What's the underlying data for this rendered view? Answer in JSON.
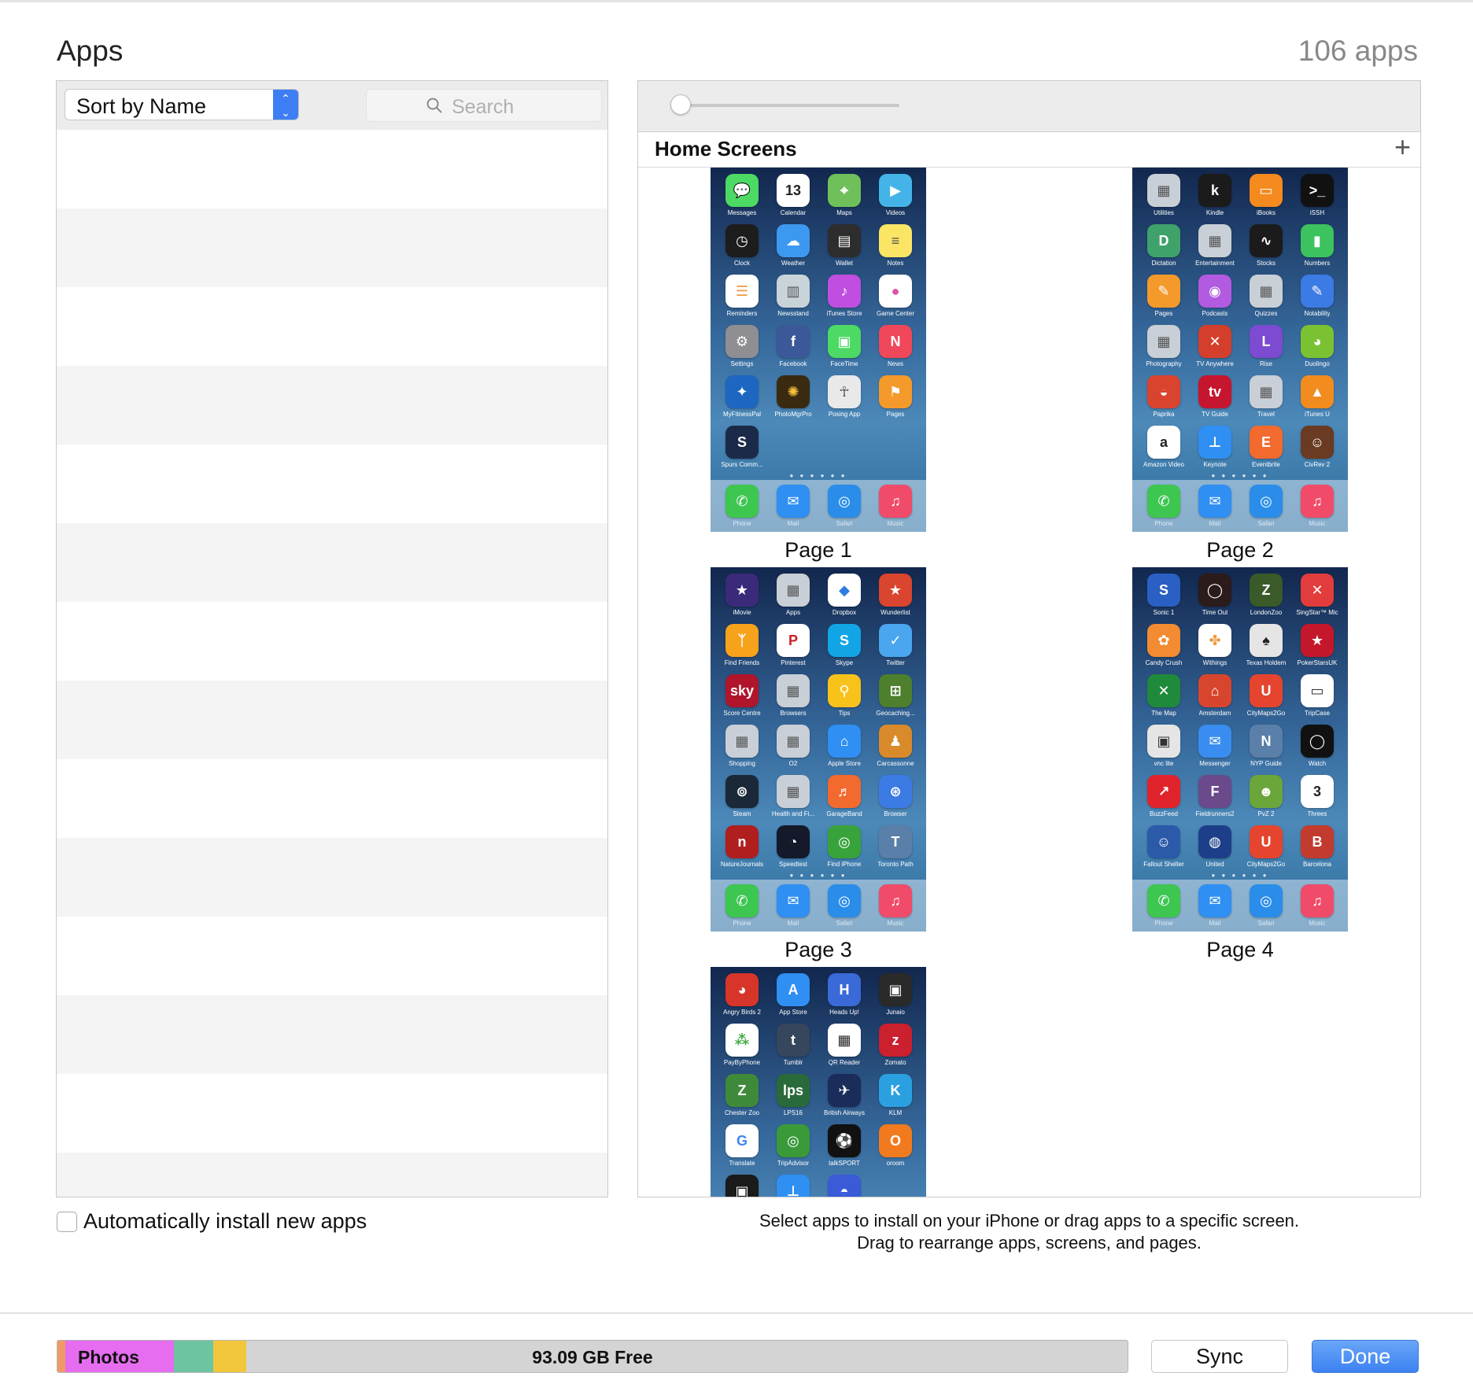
{
  "header": {
    "title": "Apps",
    "count": "106 apps"
  },
  "left": {
    "sort_label": "Sort by Name",
    "search_placeholder": "Search",
    "auto_install_label": "Automatically install new apps"
  },
  "right": {
    "section_title": "Home Screens",
    "add_symbol": "+",
    "hint_line1": "Select apps to install on your iPhone or drag apps to a specific screen.",
    "hint_line2": "Drag to rearrange apps, screens, and pages."
  },
  "dock": [
    {
      "label": "Phone",
      "color": "#3dc650",
      "glyph": "✆"
    },
    {
      "label": "Mail",
      "color": "#2f8ff2",
      "glyph": "✉"
    },
    {
      "label": "Safari",
      "color": "#2a8de9",
      "glyph": "◎"
    },
    {
      "label": "Music",
      "color": "#f14b6a",
      "glyph": "♫"
    }
  ],
  "pages": [
    {
      "label": "Page 1",
      "apps": [
        {
          "label": "Messages",
          "color": "#4cd964",
          "glyph": "💬"
        },
        {
          "label": "Calendar",
          "color": "#ffffff",
          "glyph": "13",
          "fg": "#222"
        },
        {
          "label": "Maps",
          "color": "#6fc05a",
          "glyph": "⌖"
        },
        {
          "label": "Videos",
          "color": "#44b4e8",
          "glyph": "▶"
        },
        {
          "label": "Clock",
          "color": "#1d1d1d",
          "glyph": "◷"
        },
        {
          "label": "Weather",
          "color": "#3d98f0",
          "glyph": "☁"
        },
        {
          "label": "Wallet",
          "color": "#2d2d2d",
          "glyph": "▤"
        },
        {
          "label": "Notes",
          "color": "#fbe565",
          "glyph": "≡",
          "fg": "#555"
        },
        {
          "label": "Reminders",
          "color": "#ffffff",
          "glyph": "☰",
          "fg": "#e94"
        },
        {
          "label": "Newsstand",
          "color": "#c9d4da",
          "glyph": "▥",
          "fg": "#555"
        },
        {
          "label": "iTunes Store",
          "color": "#c04ee0",
          "glyph": "♪"
        },
        {
          "label": "Game Center",
          "color": "#ffffff",
          "glyph": "●",
          "fg": "#d5a"
        },
        {
          "label": "Settings",
          "color": "#8e8e93",
          "glyph": "⚙"
        },
        {
          "label": "Facebook",
          "color": "#3b5998",
          "glyph": "f"
        },
        {
          "label": "FaceTime",
          "color": "#4cd964",
          "glyph": "▣"
        },
        {
          "label": "News",
          "color": "#f0475a",
          "glyph": "N"
        },
        {
          "label": "MyFitnessPal",
          "color": "#1d67c1",
          "glyph": "✦"
        },
        {
          "label": "PhotoMgrPro",
          "color": "#3a2a10",
          "glyph": "✺",
          "fg": "#f8c13a"
        },
        {
          "label": "Posing App",
          "color": "#e9e9e9",
          "glyph": "☥",
          "fg": "#555"
        },
        {
          "label": "Pages",
          "color": "#f39a2b",
          "glyph": "⚑"
        },
        {
          "label": "Spurs Comm...",
          "color": "#1c2a4a",
          "glyph": "S"
        }
      ]
    },
    {
      "label": "Page 2",
      "apps": [
        {
          "label": "Utilities",
          "color": "#c9cfd6",
          "glyph": "▦",
          "fg": "#555"
        },
        {
          "label": "Kindle",
          "color": "#1b1b1b",
          "glyph": "k"
        },
        {
          "label": "iBooks",
          "color": "#f58a1f",
          "glyph": "▭"
        },
        {
          "label": "iSSH",
          "color": "#111111",
          "glyph": ">_"
        },
        {
          "label": "Dictation",
          "color": "#3fa26b",
          "glyph": "D"
        },
        {
          "label": "Entertainment",
          "color": "#c9cfd6",
          "glyph": "▦",
          "fg": "#555"
        },
        {
          "label": "Stocks",
          "color": "#1b1b1b",
          "glyph": "∿"
        },
        {
          "label": "Numbers",
          "color": "#3cc35f",
          "glyph": "▮"
        },
        {
          "label": "Pages",
          "color": "#f39a2b",
          "glyph": "✎"
        },
        {
          "label": "Podcasts",
          "color": "#b25ae0",
          "glyph": "◉"
        },
        {
          "label": "Quizzes",
          "color": "#c9cfd6",
          "glyph": "▦",
          "fg": "#555"
        },
        {
          "label": "Notability",
          "color": "#3c7ae4",
          "glyph": "✎"
        },
        {
          "label": "Photography",
          "color": "#c9cfd6",
          "glyph": "▦",
          "fg": "#555"
        },
        {
          "label": "TV Anywhere",
          "color": "#d43f2c",
          "glyph": "✕"
        },
        {
          "label": "Rise",
          "color": "#7c4bd1",
          "glyph": "L"
        },
        {
          "label": "Duolingo",
          "color": "#7ac232",
          "glyph": "◕"
        },
        {
          "label": "Paprika",
          "color": "#d9442e",
          "glyph": "◒"
        },
        {
          "label": "TV Guide",
          "color": "#c6152f",
          "glyph": "tv"
        },
        {
          "label": "Travel",
          "color": "#c9cfd6",
          "glyph": "▦",
          "fg": "#555"
        },
        {
          "label": "iTunes U",
          "color": "#f28c1e",
          "glyph": "▲"
        },
        {
          "label": "Amazon Video",
          "color": "#ffffff",
          "glyph": "a",
          "fg": "#222"
        },
        {
          "label": "Keynote",
          "color": "#2f8ff2",
          "glyph": "⊥"
        },
        {
          "label": "Eventbrite",
          "color": "#f26a2e",
          "glyph": "E"
        },
        {
          "label": "CivRev 2",
          "color": "#6a3a22",
          "glyph": "☺"
        }
      ]
    },
    {
      "label": "Page 3",
      "apps": [
        {
          "label": "iMovie",
          "color": "#3b2a7a",
          "glyph": "★"
        },
        {
          "label": "Apps",
          "color": "#c9cfd6",
          "glyph": "▦",
          "fg": "#555"
        },
        {
          "label": "Dropbox",
          "color": "#ffffff",
          "glyph": "◆",
          "fg": "#2d7de1"
        },
        {
          "label": "Wunderlist",
          "color": "#d9452e",
          "glyph": "★"
        },
        {
          "label": "Find Friends",
          "color": "#f7a21b",
          "glyph": "ᛉ"
        },
        {
          "label": "Pinterest",
          "color": "#ffffff",
          "glyph": "P",
          "fg": "#cb2027"
        },
        {
          "label": "Skype",
          "color": "#12a5e6",
          "glyph": "S"
        },
        {
          "label": "Twitter",
          "color": "#4aa6ef",
          "glyph": "✓"
        },
        {
          "label": "Score Centre",
          "color": "#b0152c",
          "glyph": "sky"
        },
        {
          "label": "Browsers",
          "color": "#c9cfd6",
          "glyph": "▦",
          "fg": "#555"
        },
        {
          "label": "Tips",
          "color": "#f9c21b",
          "glyph": "⚲"
        },
        {
          "label": "Geocaching...",
          "color": "#4d7f2d",
          "glyph": "⊞"
        },
        {
          "label": "Shopping",
          "color": "#c9cfd6",
          "glyph": "▦",
          "fg": "#555"
        },
        {
          "label": "O2",
          "color": "#c9cfd6",
          "glyph": "▦",
          "fg": "#555"
        },
        {
          "label": "Apple Store",
          "color": "#2f8ff2",
          "glyph": "⌂"
        },
        {
          "label": "Carcassonne",
          "color": "#d98a2a",
          "glyph": "♟"
        },
        {
          "label": "Steam",
          "color": "#1b2838",
          "glyph": "⊚"
        },
        {
          "label": "Health and Fi...",
          "color": "#c9cfd6",
          "glyph": "▦",
          "fg": "#555"
        },
        {
          "label": "GarageBand",
          "color": "#f26a2e",
          "glyph": "♬"
        },
        {
          "label": "Browser",
          "color": "#3c7ae4",
          "glyph": "⊛"
        },
        {
          "label": "NatureJournals",
          "color": "#b01e1e",
          "glyph": "n"
        },
        {
          "label": "Speedtest",
          "color": "#141a2a",
          "glyph": "◔"
        },
        {
          "label": "Find iPhone",
          "color": "#38a33a",
          "glyph": "◎"
        },
        {
          "label": "Toronto Path",
          "color": "#5a7fa8",
          "glyph": "T"
        }
      ]
    },
    {
      "label": "Page 4",
      "apps": [
        {
          "label": "Sonic 1",
          "color": "#2a5fc4",
          "glyph": "S"
        },
        {
          "label": "Time Out",
          "color": "#2b1b1b",
          "glyph": "◯"
        },
        {
          "label": "LondonZoo",
          "color": "#3a5a2a",
          "glyph": "Z"
        },
        {
          "label": "SingStar™ Mic",
          "color": "#e23c3c",
          "glyph": "✕"
        },
        {
          "label": "Candy Crush",
          "color": "#f38b33",
          "glyph": "✿"
        },
        {
          "label": "Withings",
          "color": "#ffffff",
          "glyph": "✤",
          "fg": "#e94"
        },
        {
          "label": "Texas Holdem",
          "color": "#e5e5e5",
          "glyph": "♠",
          "fg": "#222"
        },
        {
          "label": "PokerStarsUK",
          "color": "#c5172b",
          "glyph": "★"
        },
        {
          "label": "The Map",
          "color": "#1f8a3b",
          "glyph": "✕"
        },
        {
          "label": "Amsterdam",
          "color": "#d8452e",
          "glyph": "⌂"
        },
        {
          "label": "CityMaps2Go",
          "color": "#e5452e",
          "glyph": "U"
        },
        {
          "label": "TripCase",
          "color": "#ffffff",
          "glyph": "▭",
          "fg": "#333"
        },
        {
          "label": "vnc lite",
          "color": "#e5e5e5",
          "glyph": "▣",
          "fg": "#333"
        },
        {
          "label": "Messenger",
          "color": "#3a8df0",
          "glyph": "✉"
        },
        {
          "label": "NYP Guide",
          "color": "#5a7fa8",
          "glyph": "N"
        },
        {
          "label": "Watch",
          "color": "#111111",
          "glyph": "◯"
        },
        {
          "label": "BuzzFeed",
          "color": "#e1242c",
          "glyph": "↗"
        },
        {
          "label": "Fieldrunners2",
          "color": "#6a4a8a",
          "glyph": "F"
        },
        {
          "label": "PvZ 2",
          "color": "#6aa63a",
          "glyph": "☻"
        },
        {
          "label": "Threes",
          "color": "#ffffff",
          "glyph": "3",
          "fg": "#222"
        },
        {
          "label": "Fallout Shelter",
          "color": "#2a5aa8",
          "glyph": "☺"
        },
        {
          "label": "United",
          "color": "#1d3f8a",
          "glyph": "◍"
        },
        {
          "label": "CityMaps2Go",
          "color": "#e5452e",
          "glyph": "U"
        },
        {
          "label": "Barcelona",
          "color": "#c33b2e",
          "glyph": "B"
        }
      ]
    },
    {
      "label": "",
      "apps": [
        {
          "label": "Angry Birds 2",
          "color": "#d8352a",
          "glyph": "◕"
        },
        {
          "label": "App Store",
          "color": "#2f8ff2",
          "glyph": "A"
        },
        {
          "label": "Heads Up!",
          "color": "#3a6ad8",
          "glyph": "H"
        },
        {
          "label": "Junaio",
          "color": "#2a2a2a",
          "glyph": "▣"
        },
        {
          "label": "PayByPhone",
          "color": "#ffffff",
          "glyph": "⁂",
          "fg": "#4a4"
        },
        {
          "label": "Tumblr",
          "color": "#36465d",
          "glyph": "t"
        },
        {
          "label": "QR Reader",
          "color": "#ffffff",
          "glyph": "▦",
          "fg": "#222"
        },
        {
          "label": "Zomato",
          "color": "#cb202d",
          "glyph": "z"
        },
        {
          "label": "Chester Zoo",
          "color": "#3f8a3a",
          "glyph": "Z"
        },
        {
          "label": "LPS16",
          "color": "#2a6a3a",
          "glyph": "lps"
        },
        {
          "label": "British Airways",
          "color": "#1a2d5a",
          "glyph": "✈"
        },
        {
          "label": "KLM",
          "color": "#2aa0e0",
          "glyph": "K"
        },
        {
          "label": "Translate",
          "color": "#ffffff",
          "glyph": "G",
          "fg": "#4285f4"
        },
        {
          "label": "TripAdvisor",
          "color": "#3a9a3a",
          "glyph": "◎"
        },
        {
          "label": "talkSPORT",
          "color": "#111111",
          "glyph": "⚽"
        },
        {
          "label": "oroom",
          "color": "#f27a1e",
          "glyph": "O"
        },
        {
          "label": "",
          "color": "#1b1b1b",
          "glyph": "▣"
        },
        {
          "label": "",
          "color": "#2f8ff2",
          "glyph": "⊥"
        },
        {
          "label": "",
          "color": "#3a5ad8",
          "glyph": "◓"
        }
      ]
    }
  ],
  "storage": {
    "photos_label": "Photos",
    "free_label": "93.09 GB Free"
  },
  "buttons": {
    "sync": "Sync",
    "done": "Done"
  }
}
